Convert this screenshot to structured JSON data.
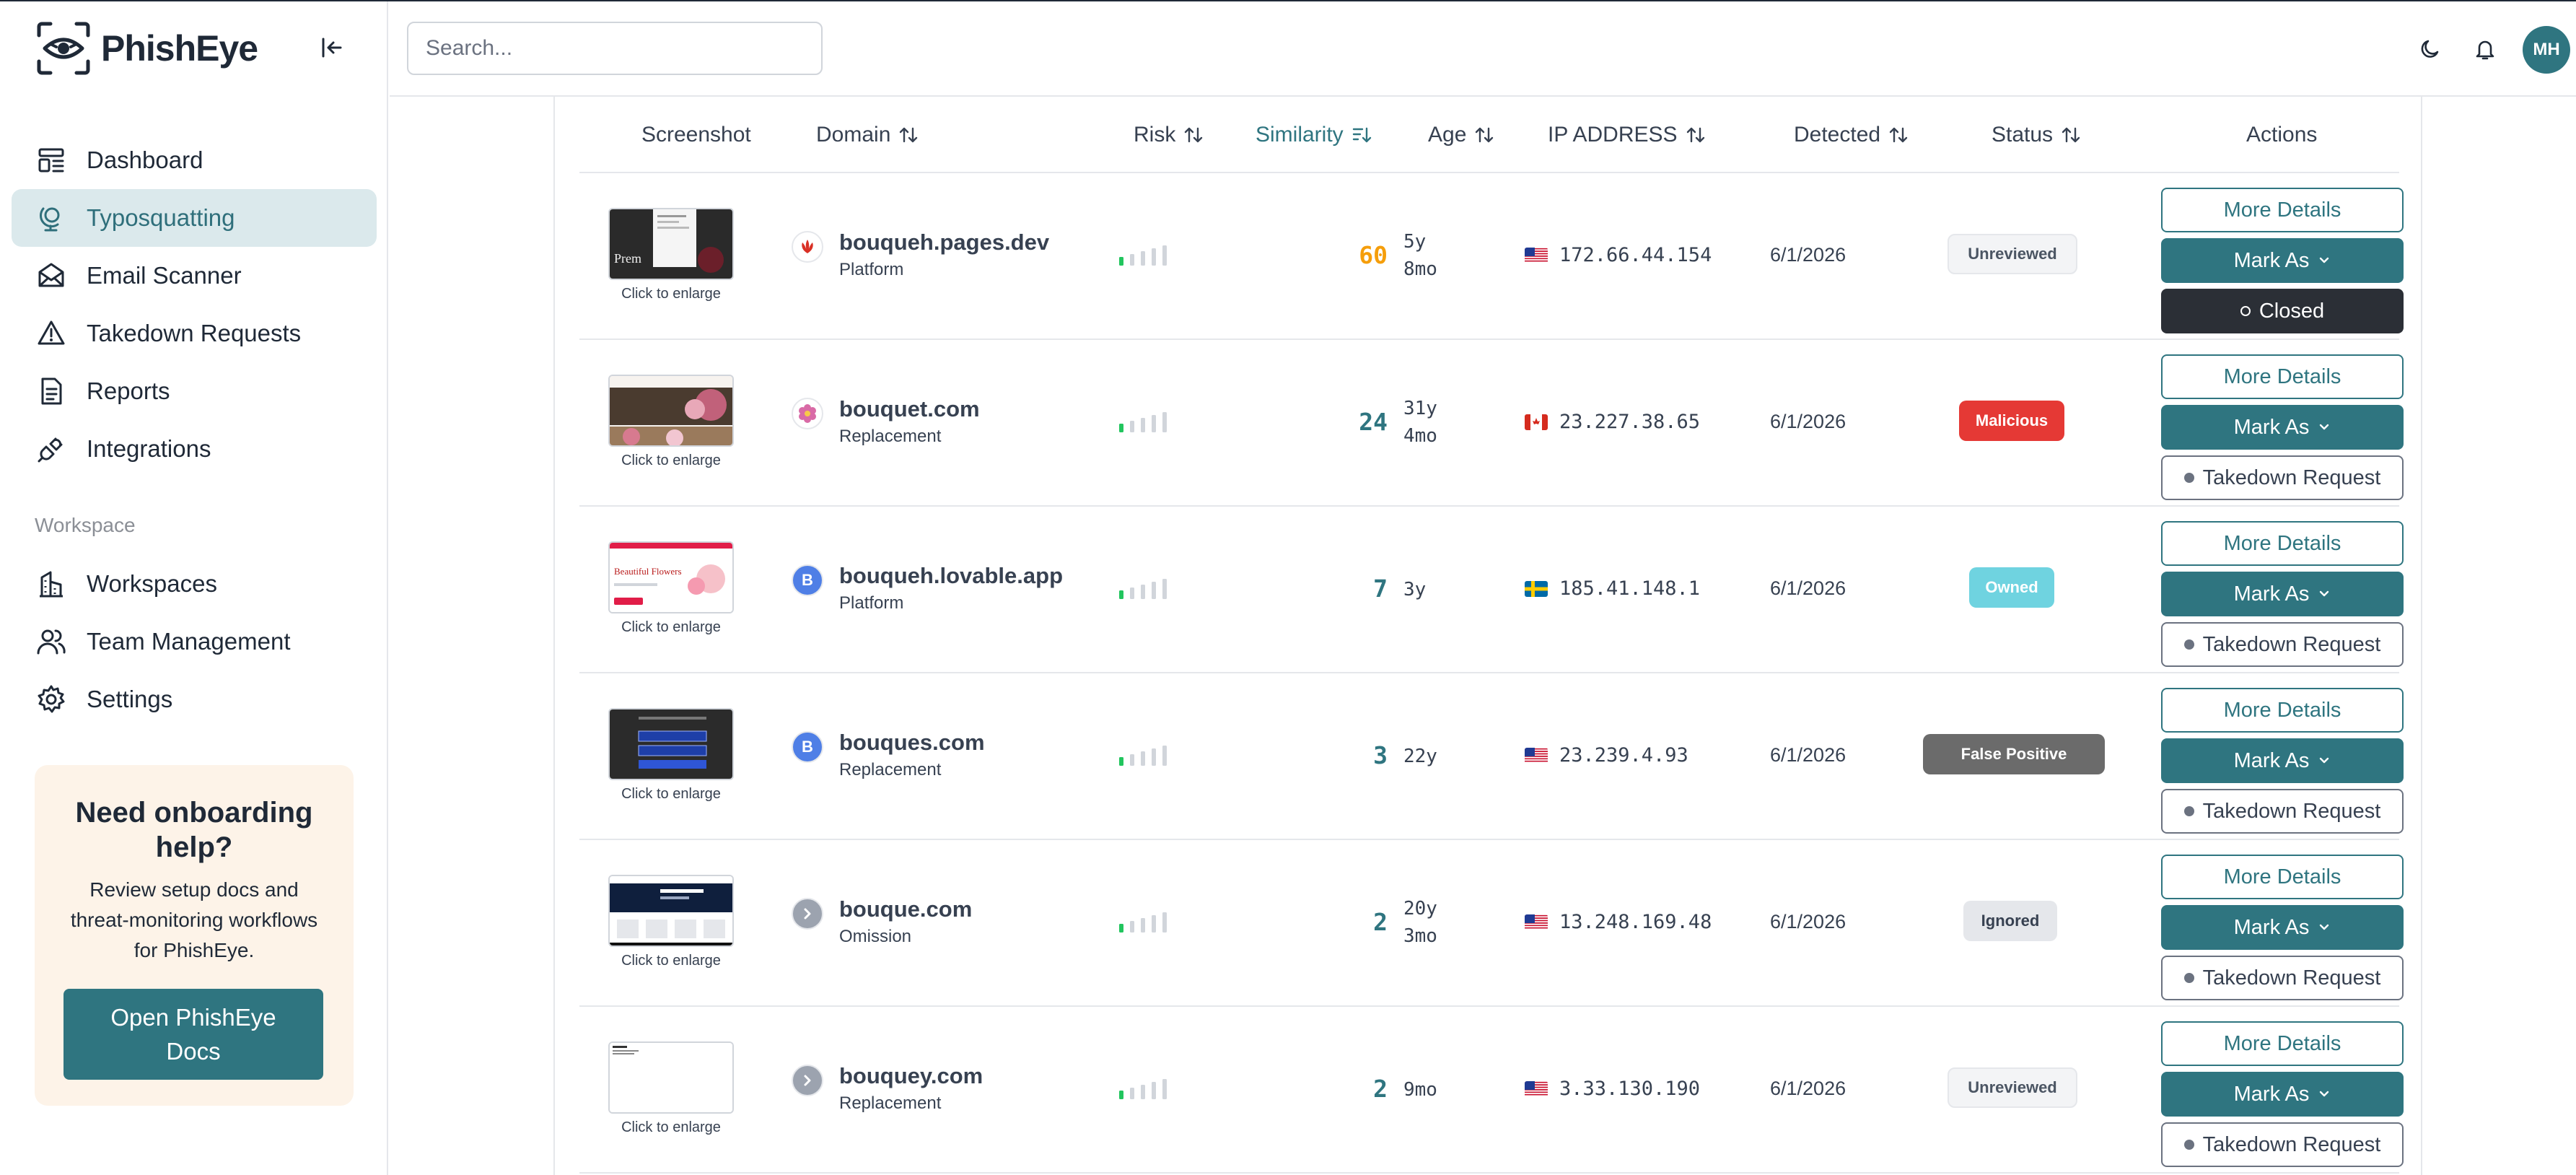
{
  "app": {
    "name": "PhishEye"
  },
  "sidebar": {
    "items": [
      {
        "label": "Dashboard",
        "icon": "dashboard-icon"
      },
      {
        "label": "Typosquatting",
        "icon": "globe-stand-icon",
        "active": true
      },
      {
        "label": "Email Scanner",
        "icon": "mail-icon"
      },
      {
        "label": "Takedown Requests",
        "icon": "warning-triangle-icon"
      },
      {
        "label": "Reports",
        "icon": "document-icon"
      },
      {
        "label": "Integrations",
        "icon": "plug-icon"
      }
    ],
    "section_label": "Workspace",
    "workspace_items": [
      {
        "label": "Workspaces",
        "icon": "building-icon"
      },
      {
        "label": "Team Management",
        "icon": "users-icon"
      },
      {
        "label": "Settings",
        "icon": "gear-icon"
      }
    ],
    "onboarding": {
      "title": "Need onboarding help?",
      "body": "Review setup docs and threat-monitoring workflows for PhishEye.",
      "button": "Open PhishEye Docs"
    }
  },
  "topbar": {
    "search_placeholder": "Search...",
    "avatar_initials": "MH"
  },
  "table": {
    "headers": {
      "screenshot": "Screenshot",
      "domain": "Domain",
      "risk": "Risk",
      "similarity": "Similarity",
      "age": "Age",
      "ip": "IP ADDRESS",
      "detected": "Detected",
      "status": "Status",
      "actions": "Actions"
    },
    "caption": "Click to enlarge",
    "action_labels": {
      "more": "More Details",
      "mark": "Mark As",
      "takedown": "Takedown Request",
      "closed": "Closed"
    },
    "rows": [
      {
        "domain": "bouqueh.pages.dev",
        "type": "Platform",
        "risk_level": 1,
        "similarity": "60",
        "age_1": "5y",
        "age_2": "8mo",
        "flag": "us",
        "ip": "172.66.44.154",
        "detected": "6/1/2026",
        "status": "Unreviewed",
        "third_action": "closed"
      },
      {
        "domain": "bouquet.com",
        "type": "Replacement",
        "risk_level": 1,
        "similarity": "24",
        "age_1": "31y",
        "age_2": "4mo",
        "flag": "ca",
        "ip": "23.227.38.65",
        "detected": "6/1/2026",
        "status": "Malicious",
        "third_action": "takedown"
      },
      {
        "domain": "bouqueh.lovable.app",
        "type": "Platform",
        "risk_level": 1,
        "similarity": "7",
        "age_1": "3y",
        "age_2": "",
        "flag": "se",
        "ip": "185.41.148.1",
        "detected": "6/1/2026",
        "status": "Owned",
        "third_action": "takedown"
      },
      {
        "domain": "bouques.com",
        "type": "Replacement",
        "risk_level": 1,
        "similarity": "3",
        "age_1": "22y",
        "age_2": "",
        "flag": "us",
        "ip": "23.239.4.93",
        "detected": "6/1/2026",
        "status": "False Positive",
        "third_action": "takedown"
      },
      {
        "domain": "bouque.com",
        "type": "Omission",
        "risk_level": 1,
        "similarity": "2",
        "age_1": "20y",
        "age_2": "3mo",
        "flag": "us",
        "ip": "13.248.169.48",
        "detected": "6/1/2026",
        "status": "Ignored",
        "third_action": "takedown"
      },
      {
        "domain": "bouquey.com",
        "type": "Replacement",
        "risk_level": 1,
        "similarity": "2",
        "age_1": "9mo",
        "age_2": "",
        "flag": "us",
        "ip": "3.33.130.190",
        "detected": "6/1/2026",
        "status": "Unreviewed",
        "third_action": "takedown"
      }
    ],
    "favicons": [
      "B",
      "B"
    ],
    "colors": {
      "accent": "#2f7580",
      "similarity_high": "#f59e0b",
      "similarity_normal": "#2f7580",
      "risk_on": "#22c55e",
      "risk_off": "#d1d5db"
    }
  }
}
